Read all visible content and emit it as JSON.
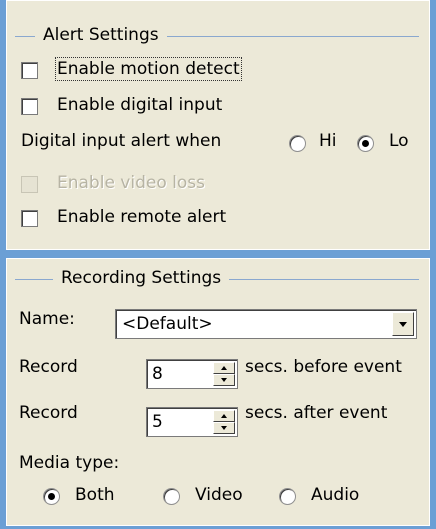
{
  "alert": {
    "legend": "Alert Settings",
    "motion": {
      "label": "Enable motion detect",
      "checked": false
    },
    "digital": {
      "label": "Enable digital input",
      "checked": false
    },
    "digital_when": {
      "label": "Digital input alert when",
      "hi": "Hi",
      "lo": "Lo",
      "selected": "Lo"
    },
    "video_loss": {
      "label": "Enable video loss",
      "enabled": false
    },
    "remote": {
      "label": "Enable remote alert",
      "checked": false
    }
  },
  "recording": {
    "legend": "Recording Settings",
    "name_label": "Name:",
    "name_value": "<Default>",
    "record_before": {
      "label": "Record",
      "value": "8",
      "suffix": "secs. before event"
    },
    "record_after": {
      "label": "Record",
      "value": "5",
      "suffix": "secs. after event"
    },
    "media_type": {
      "label": "Media type:",
      "options": [
        "Both",
        "Video",
        "Audio"
      ],
      "selected": "Both"
    }
  }
}
